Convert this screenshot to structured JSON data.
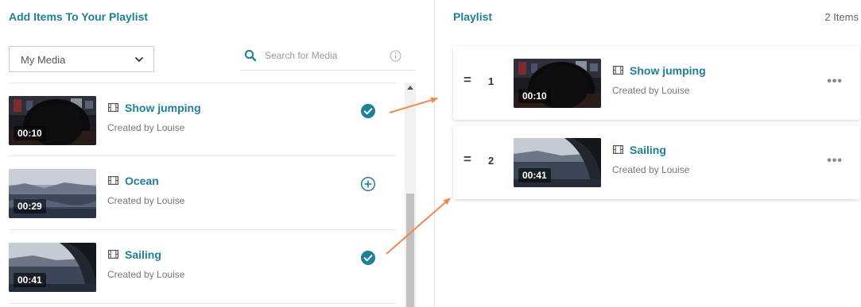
{
  "left_panel": {
    "title": "Add Items To Your Playlist",
    "filter_dropdown": {
      "selected": "My Media"
    },
    "search": {
      "placeholder": "Search for Media",
      "value": ""
    },
    "media_items": [
      {
        "title": "Show jumping",
        "created_by": "Created by Louise",
        "duration": "00:10",
        "state": "added"
      },
      {
        "title": "Ocean",
        "created_by": "Created by Louise",
        "duration": "00:29",
        "state": "not-added"
      },
      {
        "title": "Sailing",
        "created_by": "Created by Louise",
        "duration": "00:41",
        "state": "added"
      }
    ]
  },
  "right_panel": {
    "title": "Playlist",
    "item_count": "2 Items",
    "playlist_items": [
      {
        "index": "1",
        "title": "Show jumping",
        "created_by": "Created by Louise",
        "duration": "00:10"
      },
      {
        "index": "2",
        "title": "Sailing",
        "created_by": "Created by Louise",
        "duration": "00:41"
      }
    ]
  },
  "icons": {
    "search": "search-icon",
    "info": "info-icon",
    "chevron": "chevron-down-icon",
    "media_type": "film-icon",
    "added": "check-circle-icon",
    "add": "plus-circle-icon",
    "drag": "drag-handle-icon",
    "more": "more-icon"
  },
  "colors": {
    "accent": "#1e7f95",
    "annotation_arrow": "#ef8a4e"
  }
}
